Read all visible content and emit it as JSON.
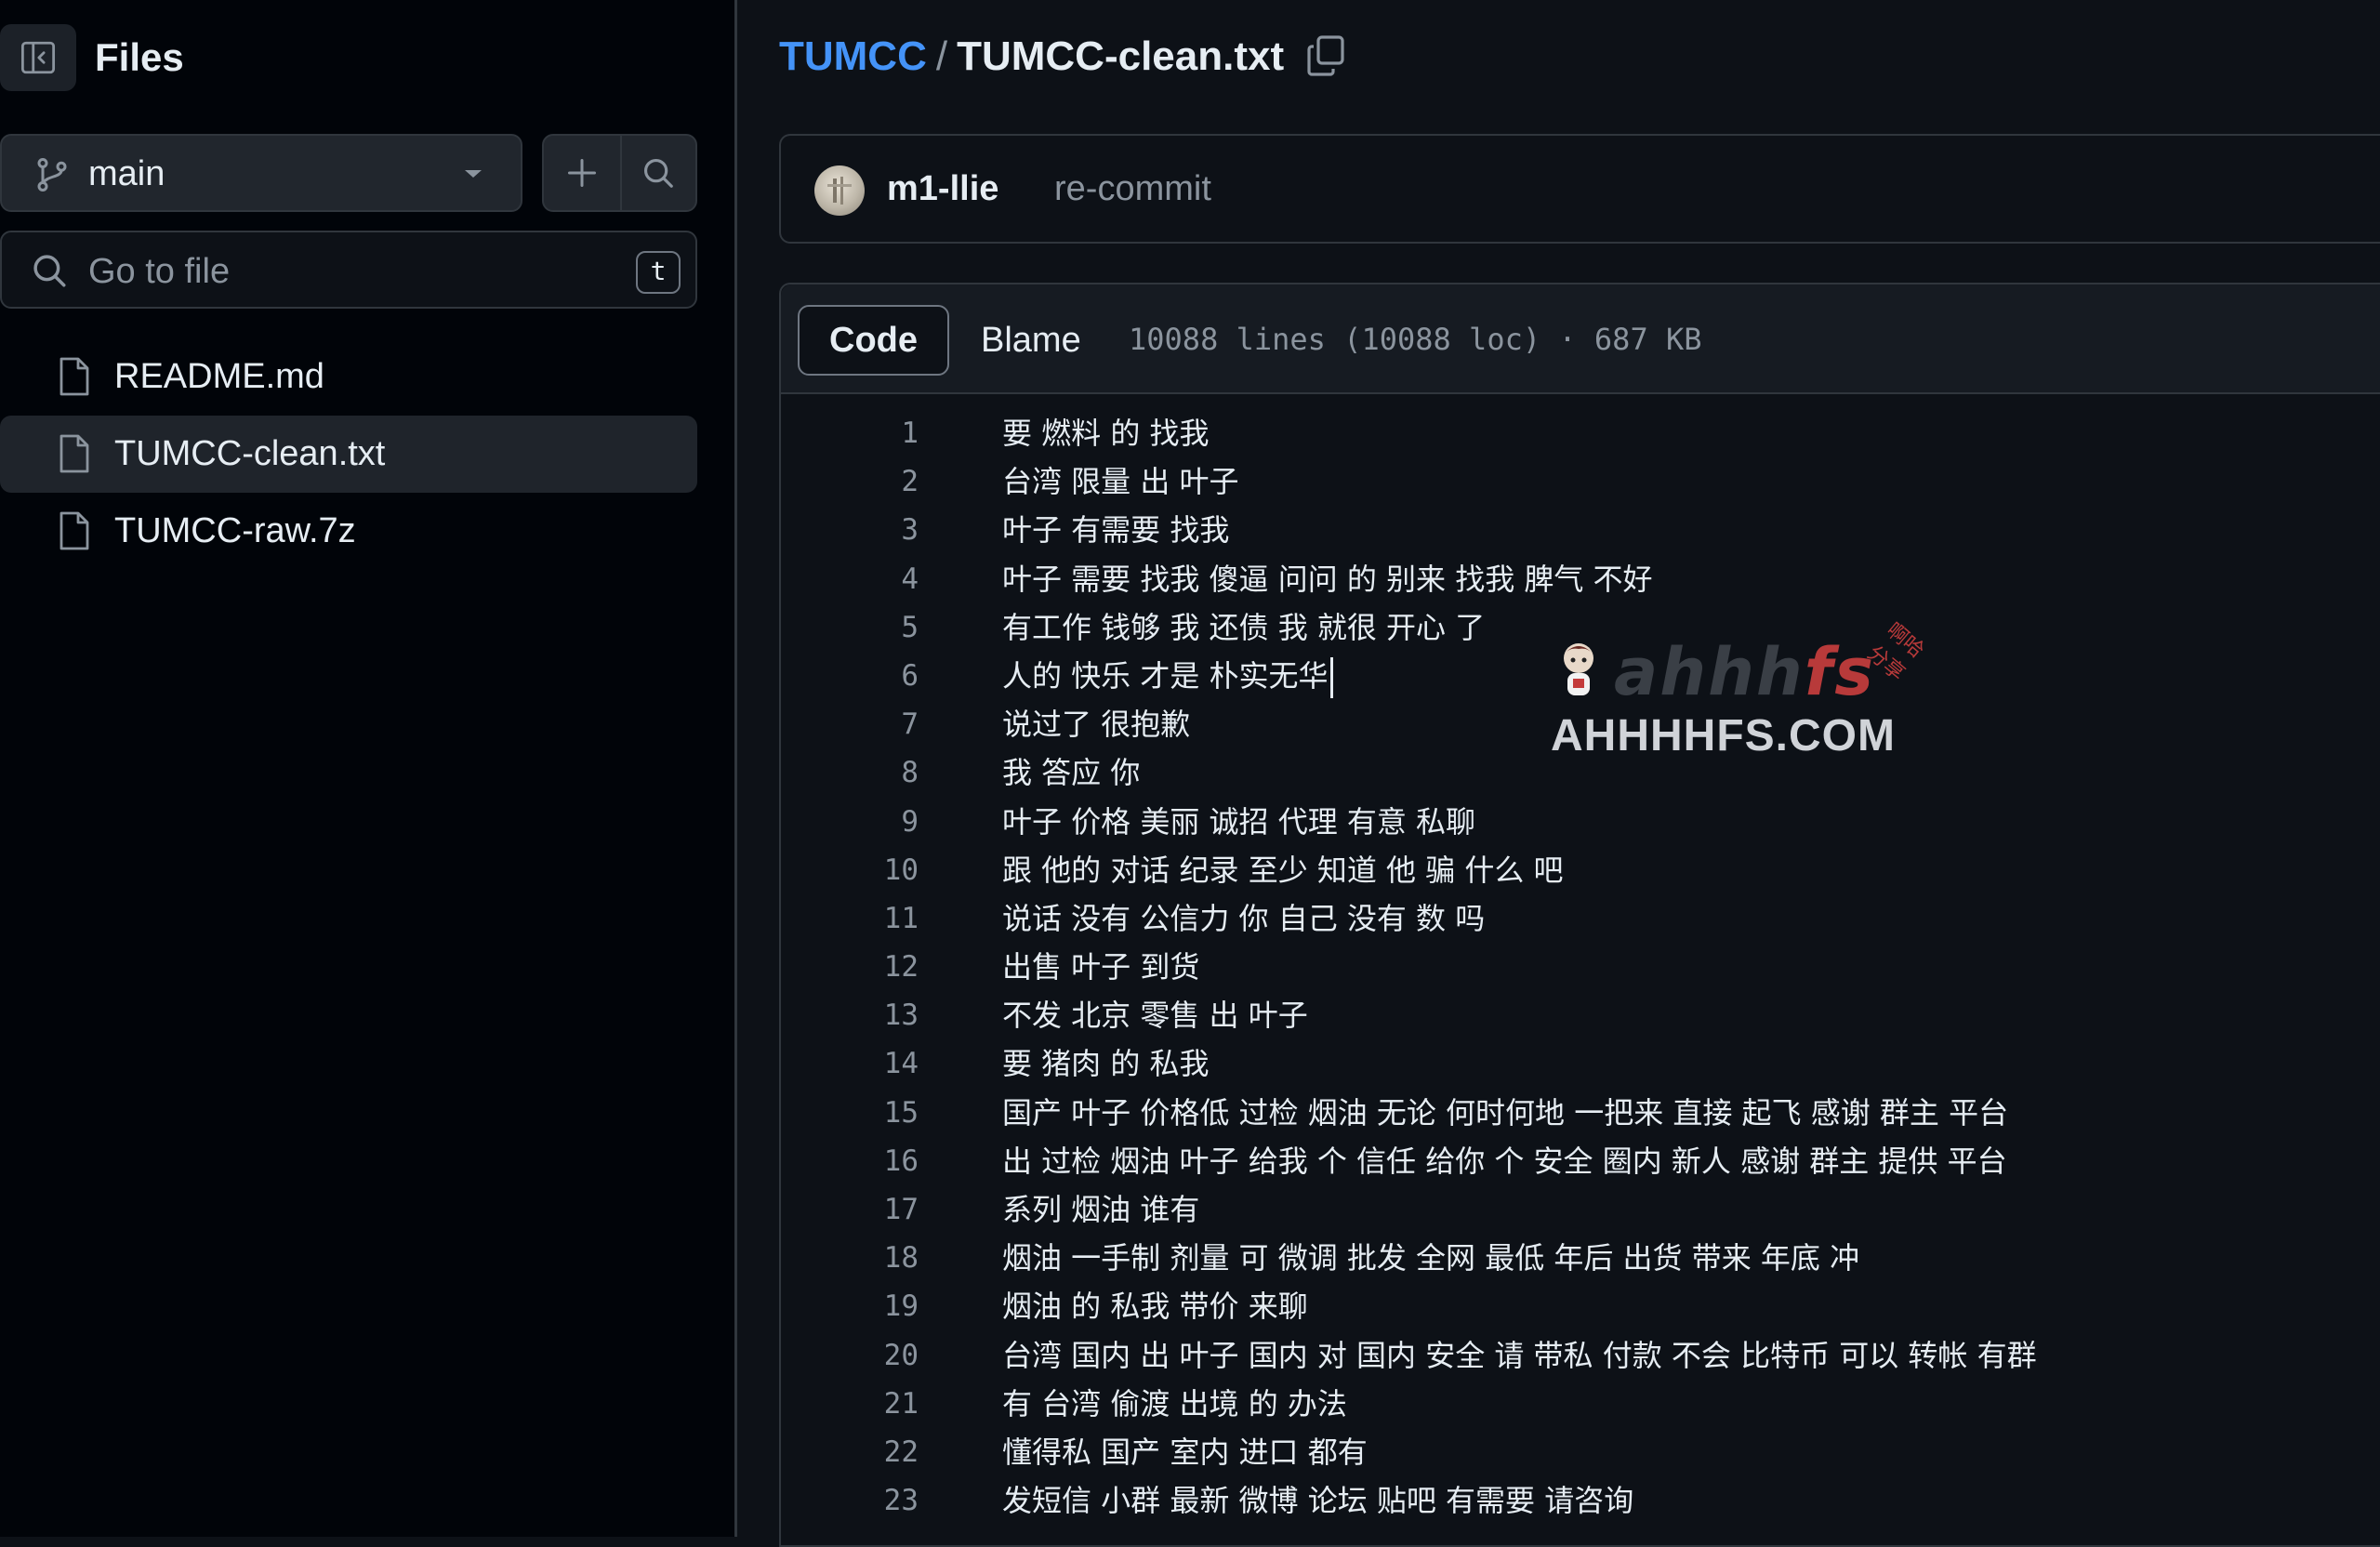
{
  "sidebar": {
    "title": "Files",
    "branch": "main",
    "goto_placeholder": "Go to file",
    "goto_shortcut": "t",
    "files": [
      {
        "name": "README.md",
        "active": false
      },
      {
        "name": "TUMCC-clean.txt",
        "active": true
      },
      {
        "name": "TUMCC-raw.7z",
        "active": false
      }
    ]
  },
  "breadcrumb": {
    "repo": "TUMCC",
    "separator": "/",
    "file": "TUMCC-clean.txt"
  },
  "commit": {
    "author": "m1-llie",
    "message": "re-commit"
  },
  "code_view": {
    "tabs": [
      "Code",
      "Blame"
    ],
    "active_tab": "Code",
    "meta": "10088 lines (10088 loc) · 687 KB",
    "lines": [
      {
        "n": "1",
        "text": "要 燃料 的 找我"
      },
      {
        "n": "2",
        "text": "台湾 限量 出 叶子"
      },
      {
        "n": "3",
        "text": "叶子 有需要 找我"
      },
      {
        "n": "4",
        "text": "叶子 需要 找我 傻逼 问问 的 别来 找我 脾气 不好"
      },
      {
        "n": "5",
        "text": "有工作 钱够 我 还债 我 就很 开心 了"
      },
      {
        "n": "6",
        "text": "人的 快乐 才是 朴实无华"
      },
      {
        "n": "7",
        "text": "说过了 很抱歉"
      },
      {
        "n": "8",
        "text": "我 答应 你"
      },
      {
        "n": "9",
        "text": "叶子 价格 美丽 诚招 代理 有意 私聊"
      },
      {
        "n": "10",
        "text": "跟 他的 对话 纪录 至少 知道 他 骗 什么 吧"
      },
      {
        "n": "11",
        "text": "说话 没有 公信力 你 自己 没有 数 吗"
      },
      {
        "n": "12",
        "text": "出售 叶子 到货"
      },
      {
        "n": "13",
        "text": "不发 北京 零售 出 叶子"
      },
      {
        "n": "14",
        "text": "要 猪肉 的 私我"
      },
      {
        "n": "15",
        "text": "国产 叶子 价格低 过检 烟油 无论 何时何地 一把来 直接 起飞 感谢 群主 平台"
      },
      {
        "n": "16",
        "text": "出 过检 烟油 叶子 给我 个 信任 给你 个 安全 圈内 新人 感谢 群主 提供 平台"
      },
      {
        "n": "17",
        "text": "系列 烟油 谁有"
      },
      {
        "n": "18",
        "text": "烟油 一手制 剂量 可 微调 批发 全网 最低 年后 出货 带来 年底 冲"
      },
      {
        "n": "19",
        "text": "烟油 的 私我 带价 来聊"
      },
      {
        "n": "20",
        "text": "台湾 国内 出 叶子 国内 对 国内 安全 请 带私 付款 不会 比特币 可以 转帐 有群"
      },
      {
        "n": "21",
        "text": "有 台湾 偷渡 出境 的 办法"
      },
      {
        "n": "22",
        "text": "懂得私 国产 室内 进口 都有"
      },
      {
        "n": "23",
        "text": "发短信 小群 最新 微博 论坛 贴吧 有需要 请咨询"
      }
    ]
  },
  "watermark": {
    "logo_dark": "ahhh",
    "logo_accent": "fs",
    "tag": "啊哈分享",
    "url": "AHHHHFS.COM"
  },
  "icons": {
    "collapse": "sidebar-collapse-icon",
    "branch": "git-branch-icon",
    "caret": "triangle-down-icon",
    "plus": "plus-icon",
    "search": "search-icon",
    "file": "file-icon",
    "copy": "copy-icon"
  },
  "colors": {
    "accent_link": "#4493f8",
    "background": "#0d1117",
    "sidebar_bg": "#010409",
    "border": "#30363d",
    "muted_text": "#8b949e"
  }
}
